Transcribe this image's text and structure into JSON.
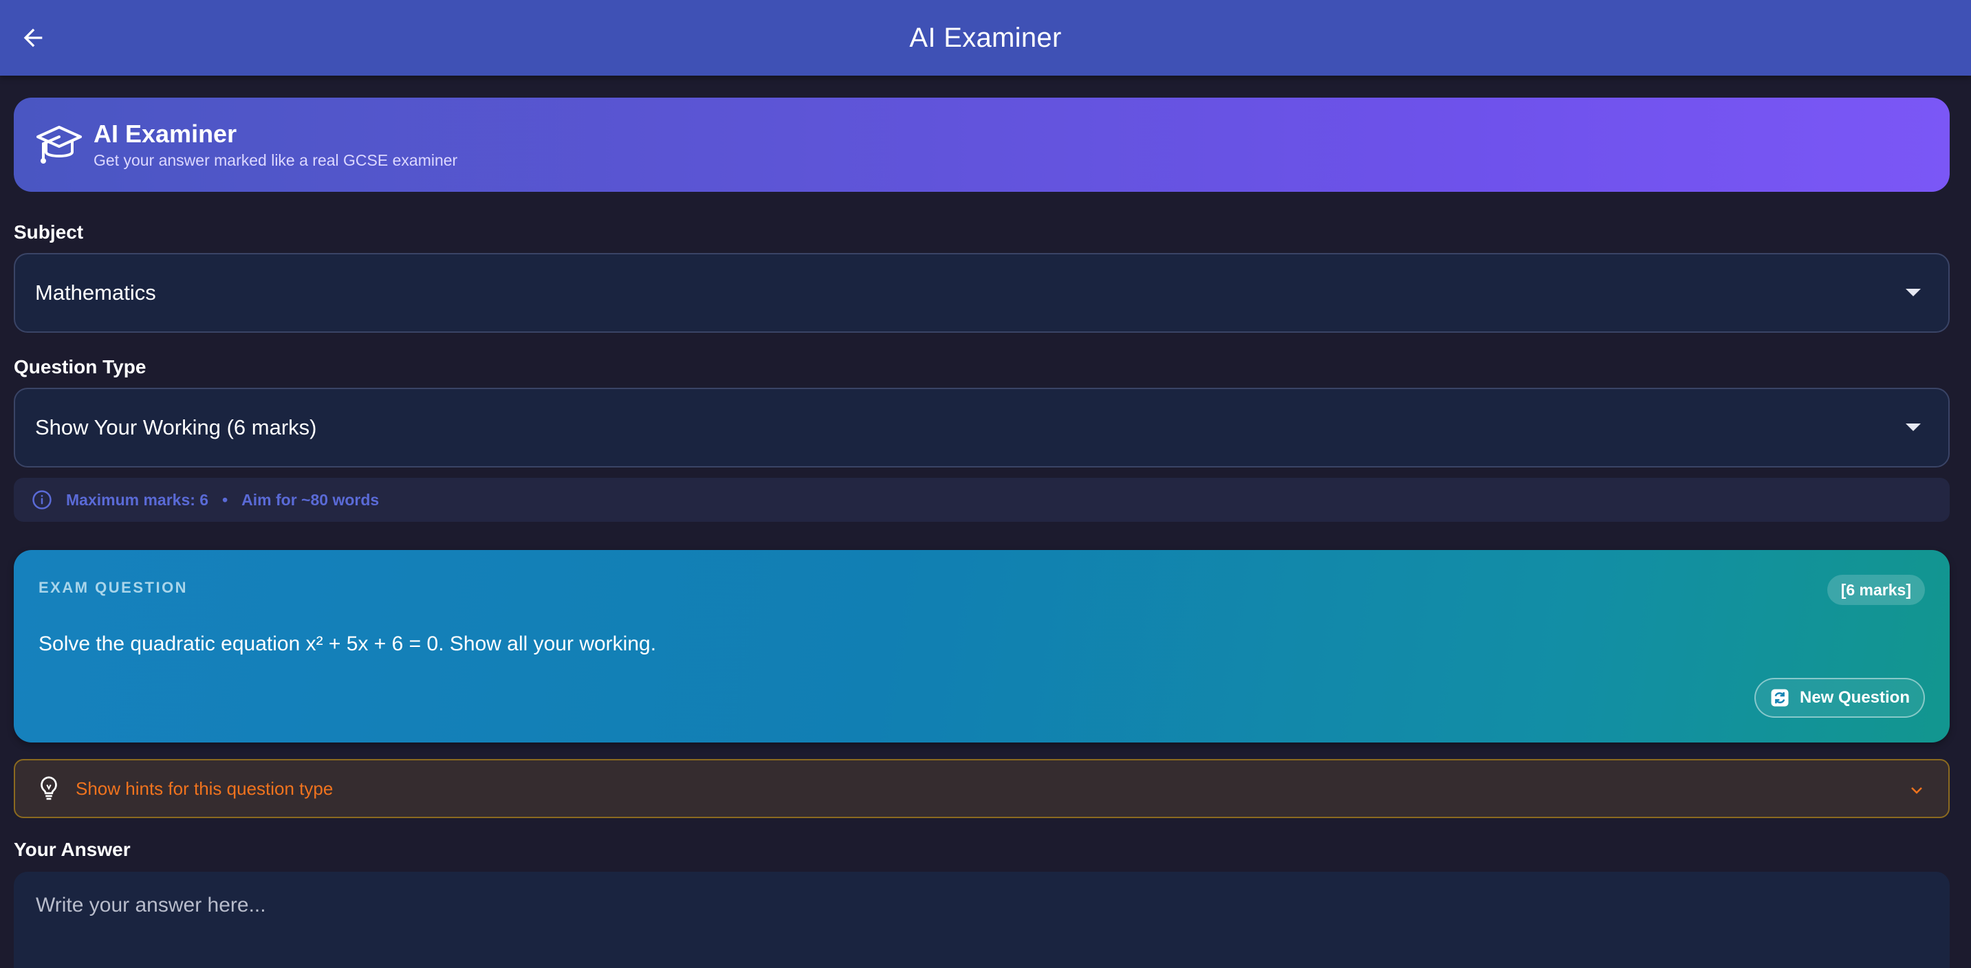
{
  "appbar": {
    "title": "AI Examiner",
    "back_icon": "arrow-left-icon"
  },
  "hero": {
    "icon": "graduation-cap-icon",
    "title": "AI Examiner",
    "subtitle": "Get your answer marked like a real GCSE examiner"
  },
  "subject": {
    "label": "Subject",
    "value": "Mathematics"
  },
  "question_type": {
    "label": "Question Type",
    "value": "Show Your Working (6 marks)"
  },
  "info": {
    "icon": "info-circle-icon",
    "max_marks": "Maximum marks: 6",
    "separator": "•",
    "aim": "Aim for ~80 words"
  },
  "exam": {
    "label": "EXAM QUESTION",
    "marks": "[6 marks]",
    "question": "Solve the quadratic equation x² + 5x + 6 = 0. Show all your working.",
    "new_question_label": "New Question",
    "new_question_icon": "refresh-icon"
  },
  "hints": {
    "icon": "lightbulb-icon",
    "label": "Show hints for this question type",
    "expand_icon": "chevron-down-icon"
  },
  "answer": {
    "label": "Your Answer",
    "placeholder": "Write your answer here..."
  },
  "colors": {
    "appbar": "#3f51b5",
    "background": "#1c1b2e",
    "hero_gradient_end": "#7b57f6",
    "exam_card": "#1681bd",
    "hint_accent": "#f0731e"
  }
}
